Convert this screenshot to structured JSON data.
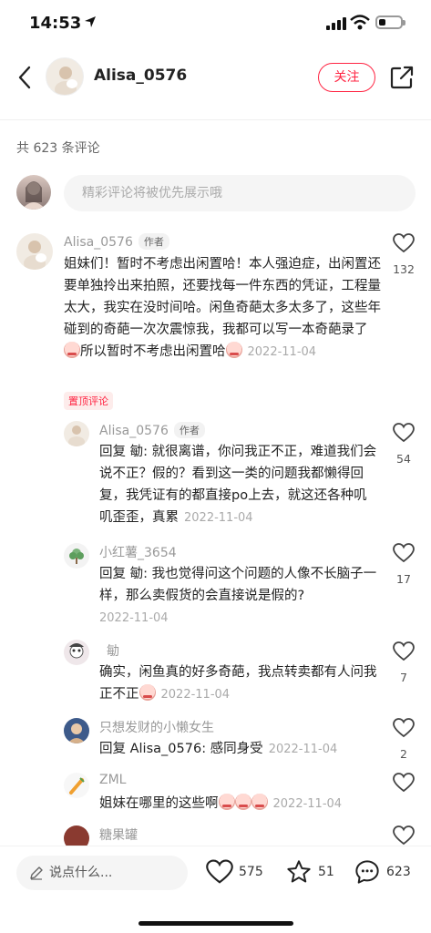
{
  "status": {
    "time": "14:53"
  },
  "header": {
    "username": "Alisa_0576",
    "follow_label": "关注"
  },
  "comment_count": "共 623 条评论",
  "comment_input_placeholder": "精彩评论将被优先展示哦",
  "comments": [
    {
      "name": "Alisa_0576",
      "badge": "作者",
      "text": "姐妹们！暂时不考虑出闲置哈！本人强迫症，出闲置还要单独拎出来拍照，还要找每一件东西的凭证，工程量太大，我实在没时间哈。闲鱼奇葩太多太多了，这些年碰到的奇葩一次次震惊我，我都可以写一本奇葩录了",
      "text_tail": "所以暂时不考虑出闲置哈",
      "date": "2022-11-04",
      "likes": "132",
      "tag": "置顶评论"
    },
    {
      "name": "Alisa_0576",
      "badge": "作者",
      "reply_prefix": "回复 ",
      "reply_to": "�michael",
      "reply_to_display": "勄",
      "text": ": 就很离谱，你问我正不正，难道我们会说不正？假的？看到这一类的问题我都懒得回复，我凭证有的都直接po上去，就这还各种叽叽歪歪，真累",
      "date": "2022-11-04",
      "likes": "54"
    },
    {
      "name": "小红薯_3654",
      "reply_prefix": "回复 ",
      "reply_to_display": "勄",
      "text": ": 我也觉得问这个问题的人像不长脑子一样，那么卖假货的会直接说是假的?",
      "date": "2022-11-04",
      "likes": "17"
    },
    {
      "name": "勄",
      "text": "确实，闲鱼真的好多奇葩，我点转卖都有人问我正不正",
      "date": "2022-11-04",
      "likes": "7"
    },
    {
      "name": "只想发财的小懒女生",
      "reply_prefix": "回复 ",
      "reply_to_display": "Alisa_0576",
      "text": ": 感同身受",
      "date": "2022-11-04",
      "likes": "2"
    },
    {
      "name": "ZML",
      "text": "姐妹在哪里的这些啊",
      "date": "2022-11-04",
      "likes": ""
    },
    {
      "name": "糖果罐"
    }
  ],
  "bottom": {
    "say_placeholder": "说点什么...",
    "likes": "575",
    "stars": "51",
    "comments": "623"
  },
  "colors": {
    "accent": "#ff2442"
  }
}
